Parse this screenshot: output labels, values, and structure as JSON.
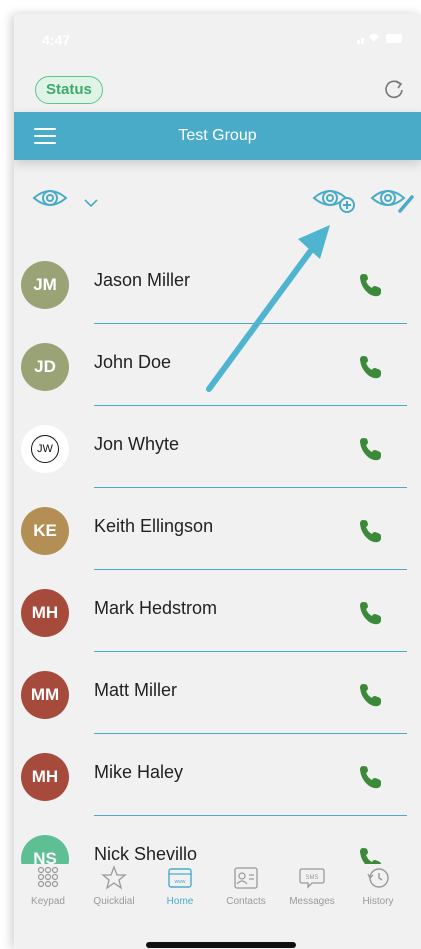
{
  "statusbar": {
    "time": "4:47"
  },
  "status_button": "Status",
  "header": {
    "title": "Test Group"
  },
  "contacts": [
    {
      "initials": "JM",
      "name": "Jason Miller",
      "color": "#9aa375"
    },
    {
      "initials": "JD",
      "name": "John Doe",
      "color": "#9aa375"
    },
    {
      "initials": "JW",
      "name": "Jon Whyte",
      "color": "#ffffff",
      "style": "outlined"
    },
    {
      "initials": "KE",
      "name": "Keith Ellingson",
      "color": "#b38f55"
    },
    {
      "initials": "MH",
      "name": "Mark Hedstrom",
      "color": "#a64a3b"
    },
    {
      "initials": "MM",
      "name": "Matt Miller",
      "color": "#a64a3b"
    },
    {
      "initials": "MH",
      "name": "Mike Haley",
      "color": "#a64a3b"
    },
    {
      "initials": "NS",
      "name": "Nick Shevillo",
      "color": "#5dbf93"
    }
  ],
  "tabs": [
    {
      "label": "Keypad",
      "icon": "keypad-icon"
    },
    {
      "label": "Quickdial",
      "icon": "star-icon"
    },
    {
      "label": "Home",
      "icon": "home-icon",
      "active": true
    },
    {
      "label": "Contacts",
      "icon": "contacts-icon"
    },
    {
      "label": "Messages",
      "icon": "sms-icon"
    },
    {
      "label": "History",
      "icon": "history-icon"
    }
  ],
  "colors": {
    "accent": "#4aabc9",
    "phone_green": "#3a8a3a",
    "status_green": "#5fc58a"
  }
}
